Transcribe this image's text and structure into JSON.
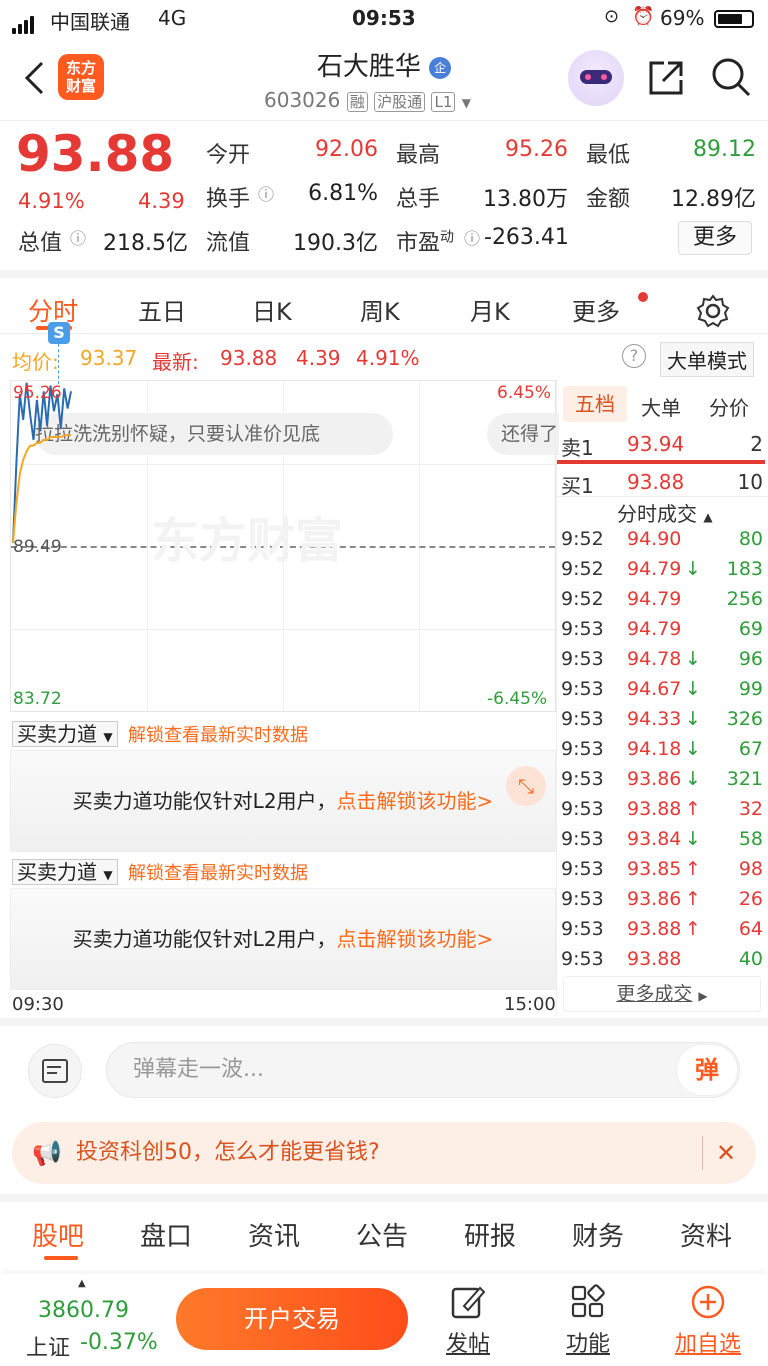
{
  "status_bar": {
    "carrier": "中国联通",
    "network": "4G",
    "time": "09:53",
    "battery": "69%"
  },
  "header": {
    "logo_text": "东方\n财富",
    "stock_name": "石大胜华",
    "enterprise_badge": "企",
    "stock_code": "603026",
    "tags": [
      "融",
      "沪股通",
      "L1"
    ]
  },
  "quote": {
    "price": "93.88",
    "change_pct": "4.91%",
    "change": "4.39",
    "open_label": "今开",
    "open": "92.06",
    "high_label": "最高",
    "high": "95.26",
    "low_label": "最低",
    "low": "89.12",
    "turnover_label": "换手",
    "turnover": "6.81%",
    "volume_label": "总手",
    "volume": "13.80万",
    "amount_label": "金额",
    "amount": "12.89亿",
    "mktcap_label": "总值",
    "mktcap": "218.5亿",
    "float_label": "流值",
    "float": "190.3亿",
    "pe_label": "市盈",
    "pe_sup": "动",
    "pe": "-263.41",
    "more": "更多"
  },
  "chart_tabs": [
    "分时",
    "五日",
    "日K",
    "周K",
    "月K",
    "更多"
  ],
  "priceline": {
    "avg_label": "均价:",
    "avg": "93.37",
    "latest_label": "最新:",
    "latest": "93.88",
    "change": "4.39",
    "pct": "4.91%",
    "mode_btn": "大单模式"
  },
  "chart": {
    "y_top": "95.26",
    "y_mid": "89.49",
    "y_bot": "83.72",
    "pct_top": "6.45%",
    "pct_bot": "-6.45%",
    "x_start": "09:30",
    "x_end": "15:00",
    "ticker1": "拉拉洗洗别怀疑，只要认准价见底",
    "ticker2": "还得了",
    "watermark": "东方财富",
    "s_badge": "S"
  },
  "chart_data": {
    "type": "line",
    "ylim": [
      83.72,
      95.26
    ],
    "prev_close": 89.49,
    "series": [
      {
        "values": [
          89.6,
          92.4,
          94.8,
          93.9,
          95.2,
          94.1,
          93.2,
          94.6,
          93.5,
          94.9,
          93.7,
          95.1,
          94.2,
          94.8,
          93.6,
          95.0,
          94.3,
          94.9
        ]
      },
      {
        "values": [
          89.6,
          91.0,
          92.0,
          92.5,
          92.8,
          93.0,
          93.0,
          93.1,
          93.1,
          93.2,
          93.2,
          93.3,
          93.3,
          93.3,
          93.3,
          93.35,
          93.37,
          93.37
        ]
      }
    ]
  },
  "book": {
    "tabs": [
      "五档",
      "大单",
      "分价"
    ],
    "ask_label": "卖1",
    "ask_price": "93.94",
    "ask_vol": "2",
    "bid_label": "买1",
    "bid_price": "93.88",
    "bid_vol": "10",
    "trades_title": "分时成交",
    "trades": [
      {
        "t": "9:52",
        "p": "94.90",
        "a": "",
        "v": "80"
      },
      {
        "t": "9:52",
        "p": "94.79",
        "a": "↓",
        "v": "183"
      },
      {
        "t": "9:52",
        "p": "94.79",
        "a": "",
        "v": "256"
      },
      {
        "t": "9:53",
        "p": "94.79",
        "a": "",
        "v": "69"
      },
      {
        "t": "9:53",
        "p": "94.78",
        "a": "↓",
        "v": "96"
      },
      {
        "t": "9:53",
        "p": "94.67",
        "a": "↓",
        "v": "99"
      },
      {
        "t": "9:53",
        "p": "94.33",
        "a": "↓",
        "v": "326"
      },
      {
        "t": "9:53",
        "p": "94.18",
        "a": "↓",
        "v": "67"
      },
      {
        "t": "9:53",
        "p": "93.86",
        "a": "↓",
        "v": "321"
      },
      {
        "t": "9:53",
        "p": "93.88",
        "a": "↑",
        "v": "32"
      },
      {
        "t": "9:53",
        "p": "93.84",
        "a": "↓",
        "v": "58"
      },
      {
        "t": "9:53",
        "p": "93.85",
        "a": "↑",
        "v": "98"
      },
      {
        "t": "9:53",
        "p": "93.86",
        "a": "↑",
        "v": "26"
      },
      {
        "t": "9:53",
        "p": "93.88",
        "a": "↑",
        "v": "64"
      },
      {
        "t": "9:53",
        "p": "93.88",
        "a": "",
        "v": "40"
      }
    ],
    "more_trades": "更多成交"
  },
  "power": {
    "label": "买卖力道",
    "unlock": "解锁查看最新实时数据",
    "msg": "买卖力道功能仅针对L2用户，",
    "cta": "点击解锁该功能>"
  },
  "comment": {
    "placeholder": "弹幕走一波...",
    "danmu": "弹"
  },
  "banner": {
    "text": "投资科创50，怎么才能更省钱?"
  },
  "bottom_tabs": [
    "股吧",
    "盘口",
    "资讯",
    "公告",
    "研报",
    "财务",
    "资料"
  ],
  "bottombar": {
    "index_value": "3860.79",
    "index_name": "上证",
    "index_pct": "-0.37%",
    "trade": "开户交易",
    "post": "发帖",
    "func": "功能",
    "add": "加自选"
  },
  "colors": {
    "up": "#e53935",
    "down": "#2e9d3a",
    "accent": "#ff5a1f",
    "price_line": "#2b6cb0",
    "avg_line": "#f5a623"
  }
}
